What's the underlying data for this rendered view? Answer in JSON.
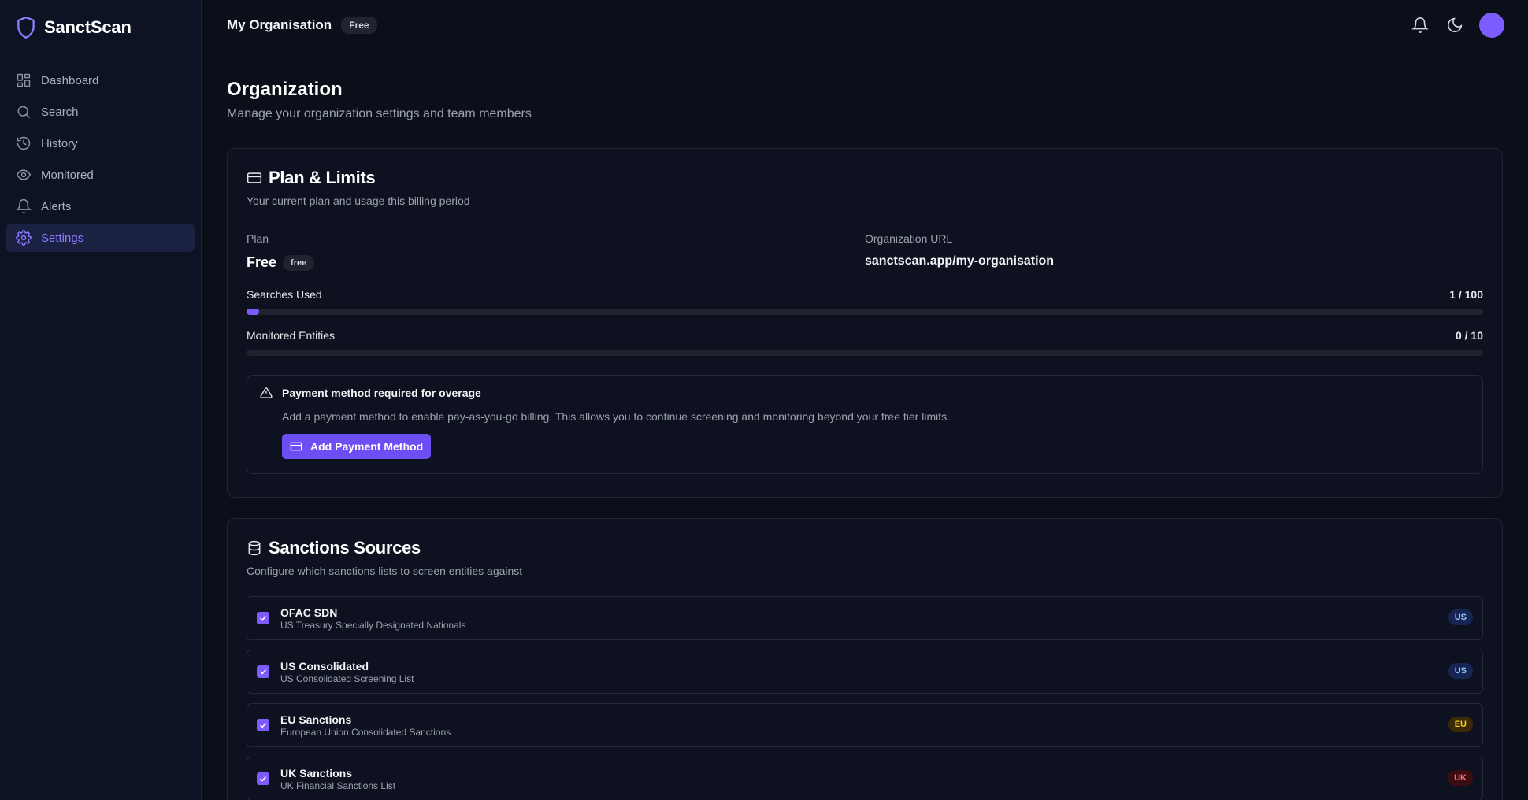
{
  "brand": {
    "name": "SanctScan"
  },
  "sidebar": {
    "items": [
      {
        "label": "Dashboard",
        "icon": "dashboard-icon"
      },
      {
        "label": "Search",
        "icon": "search-icon"
      },
      {
        "label": "History",
        "icon": "history-icon"
      },
      {
        "label": "Monitored",
        "icon": "eye-icon"
      },
      {
        "label": "Alerts",
        "icon": "bell-icon"
      },
      {
        "label": "Settings",
        "icon": "gear-icon",
        "active": true
      }
    ]
  },
  "header": {
    "org_name": "My Organisation",
    "plan_badge": "Free"
  },
  "page": {
    "title": "Organization",
    "subtitle": "Manage your organization settings and team members"
  },
  "plan_card": {
    "title": "Plan & Limits",
    "description": "Your current plan and usage this billing period",
    "plan_label": "Plan",
    "plan_value": "Free",
    "plan_badge": "free",
    "url_label": "Organization URL",
    "url_value": "sanctscan.app/my-organisation",
    "usage": [
      {
        "label": "Searches Used",
        "count": "1 / 100",
        "fraction": 0.01
      },
      {
        "label": "Monitored Entities",
        "count": "0 / 10",
        "fraction": 0
      }
    ],
    "alert": {
      "title": "Payment method required for overage",
      "text": "Add a payment method to enable pay-as-you-go billing. This allows you to continue screening and monitoring beyond your free tier limits.",
      "button_label": "Add Payment Method"
    }
  },
  "sources_card": {
    "title": "Sanctions Sources",
    "description": "Configure which sanctions lists to screen entities against",
    "sources": [
      {
        "name": "OFAC SDN",
        "description": "US Treasury Specially Designated Nationals",
        "region": "US",
        "checked": true
      },
      {
        "name": "US Consolidated",
        "description": "US Consolidated Screening List",
        "region": "US",
        "checked": true
      },
      {
        "name": "EU Sanctions",
        "description": "European Union Consolidated Sanctions",
        "region": "EU",
        "checked": true
      },
      {
        "name": "UK Sanctions",
        "description": "UK Financial Sanctions List",
        "region": "UK",
        "checked": true
      }
    ]
  },
  "colors": {
    "accent": "#7c5cff",
    "region_us_bg": "#172554",
    "region_us_fg": "#93c5fd",
    "region_eu_bg": "#3a2a06",
    "region_eu_fg": "#facc15",
    "region_uk_bg": "#3b0d12",
    "region_uk_fg": "#f87171"
  }
}
